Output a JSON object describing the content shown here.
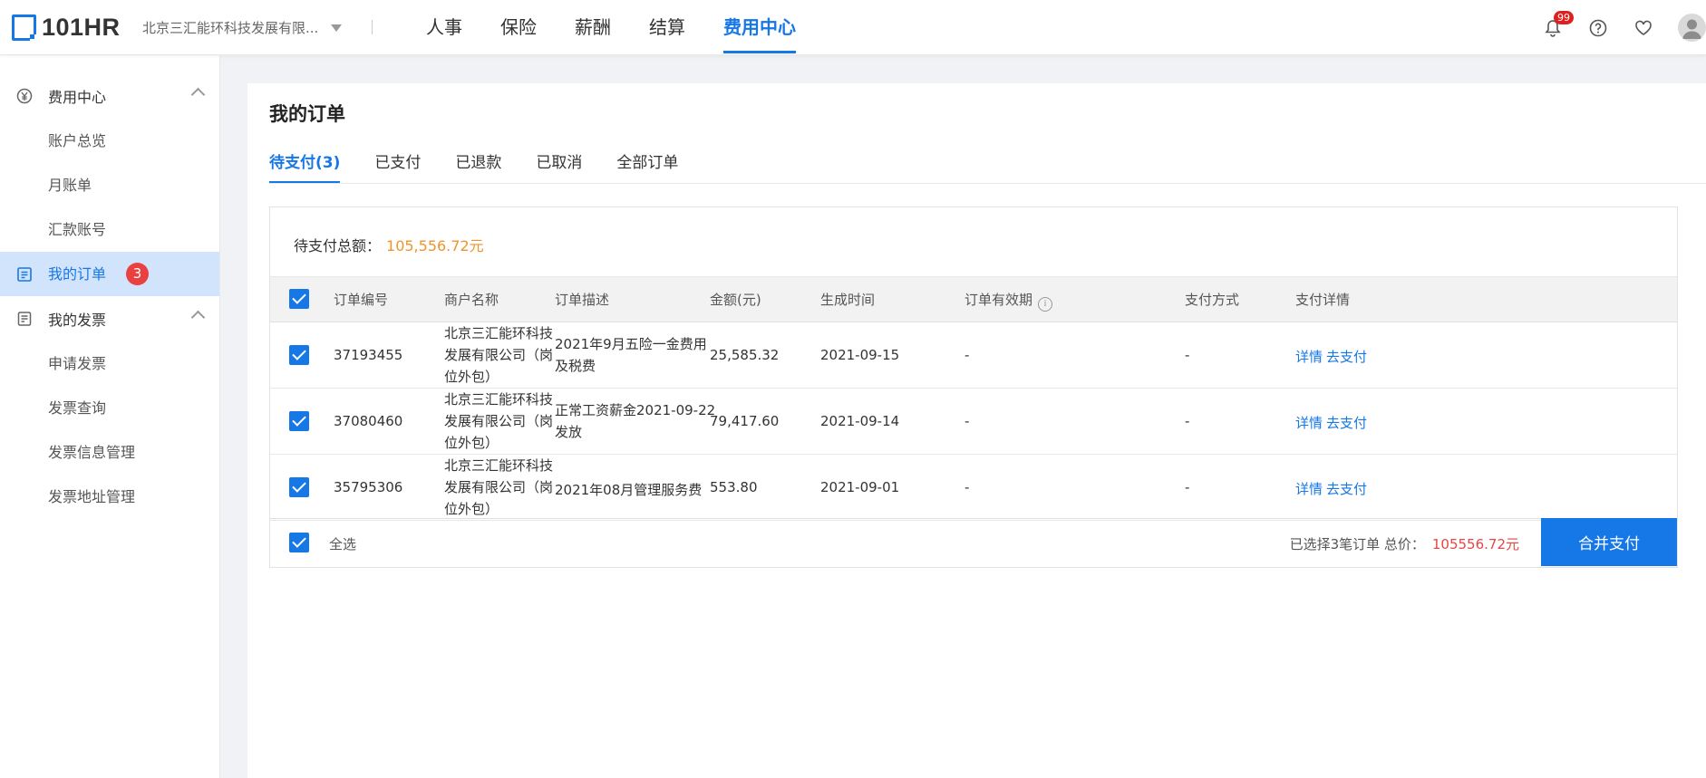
{
  "header": {
    "logo_text": "101HR",
    "company": "北京三汇能环科技发展有限...",
    "nav": [
      {
        "label": "人事",
        "active": false
      },
      {
        "label": "保险",
        "active": false
      },
      {
        "label": "薪酬",
        "active": false
      },
      {
        "label": "结算",
        "active": false
      },
      {
        "label": "费用中心",
        "active": true
      }
    ],
    "notification_count": "99",
    "icons": [
      "bell-icon",
      "help-icon",
      "heart-icon",
      "avatar-icon"
    ]
  },
  "sidebar": {
    "group1": {
      "label": "费用中心",
      "icon": "yuan-circle-icon"
    },
    "group1_items": [
      "账户总览",
      "月账单",
      "汇款账号"
    ],
    "active_item": {
      "label": "我的订单",
      "badge": "3",
      "icon": "order-icon"
    },
    "group2": {
      "label": "我的发票",
      "icon": "invoice-icon"
    },
    "group2_items": [
      "申请发票",
      "发票查询",
      "发票信息管理",
      "发票地址管理"
    ]
  },
  "main": {
    "title": "我的订单",
    "tabs": [
      {
        "label": "待支付(3)",
        "active": true
      },
      {
        "label": "已支付",
        "active": false
      },
      {
        "label": "已退款",
        "active": false
      },
      {
        "label": "已取消",
        "active": false
      },
      {
        "label": "全部订单",
        "active": false
      }
    ],
    "total_label": "待支付总额：",
    "total_amount": "105,556.72元",
    "columns": [
      "订单编号",
      "商户名称",
      "订单描述",
      "金额(元)",
      "生成时间",
      "订单有效期",
      "支付方式",
      "支付详情"
    ],
    "rows": [
      {
        "id": "37193455",
        "merchant": "北京三汇能环科技发展有限公司（岗位外包）",
        "desc": "2021年9月五险一金费用及税费",
        "amount": "25,585.32",
        "created": "2021-09-15",
        "validity": "-",
        "pay_method": "-",
        "detail_label": "详情",
        "pay_label": "去支付",
        "checked": true
      },
      {
        "id": "37080460",
        "merchant": "北京三汇能环科技发展有限公司（岗位外包）",
        "desc": "正常工资薪金2021-09-22发放",
        "amount": "79,417.60",
        "created": "2021-09-14",
        "validity": "-",
        "pay_method": "-",
        "detail_label": "详情",
        "pay_label": "去支付",
        "checked": true
      },
      {
        "id": "35795306",
        "merchant": "北京三汇能环科技发展有限公司（岗位外包）",
        "desc": "2021年08月管理服务费",
        "amount": "553.80",
        "created": "2021-09-01",
        "validity": "-",
        "pay_method": "-",
        "detail_label": "详情",
        "pay_label": "去支付",
        "checked": true
      }
    ],
    "select_all_label": "全选",
    "summary_label": "已选择3笔订单 总价：",
    "summary_price": "105556.72元",
    "pay_button": "合并支付"
  },
  "colors": {
    "accent": "#1677e6",
    "amount": "#f0932b",
    "price": "#e64545",
    "badge": "#e94040"
  }
}
